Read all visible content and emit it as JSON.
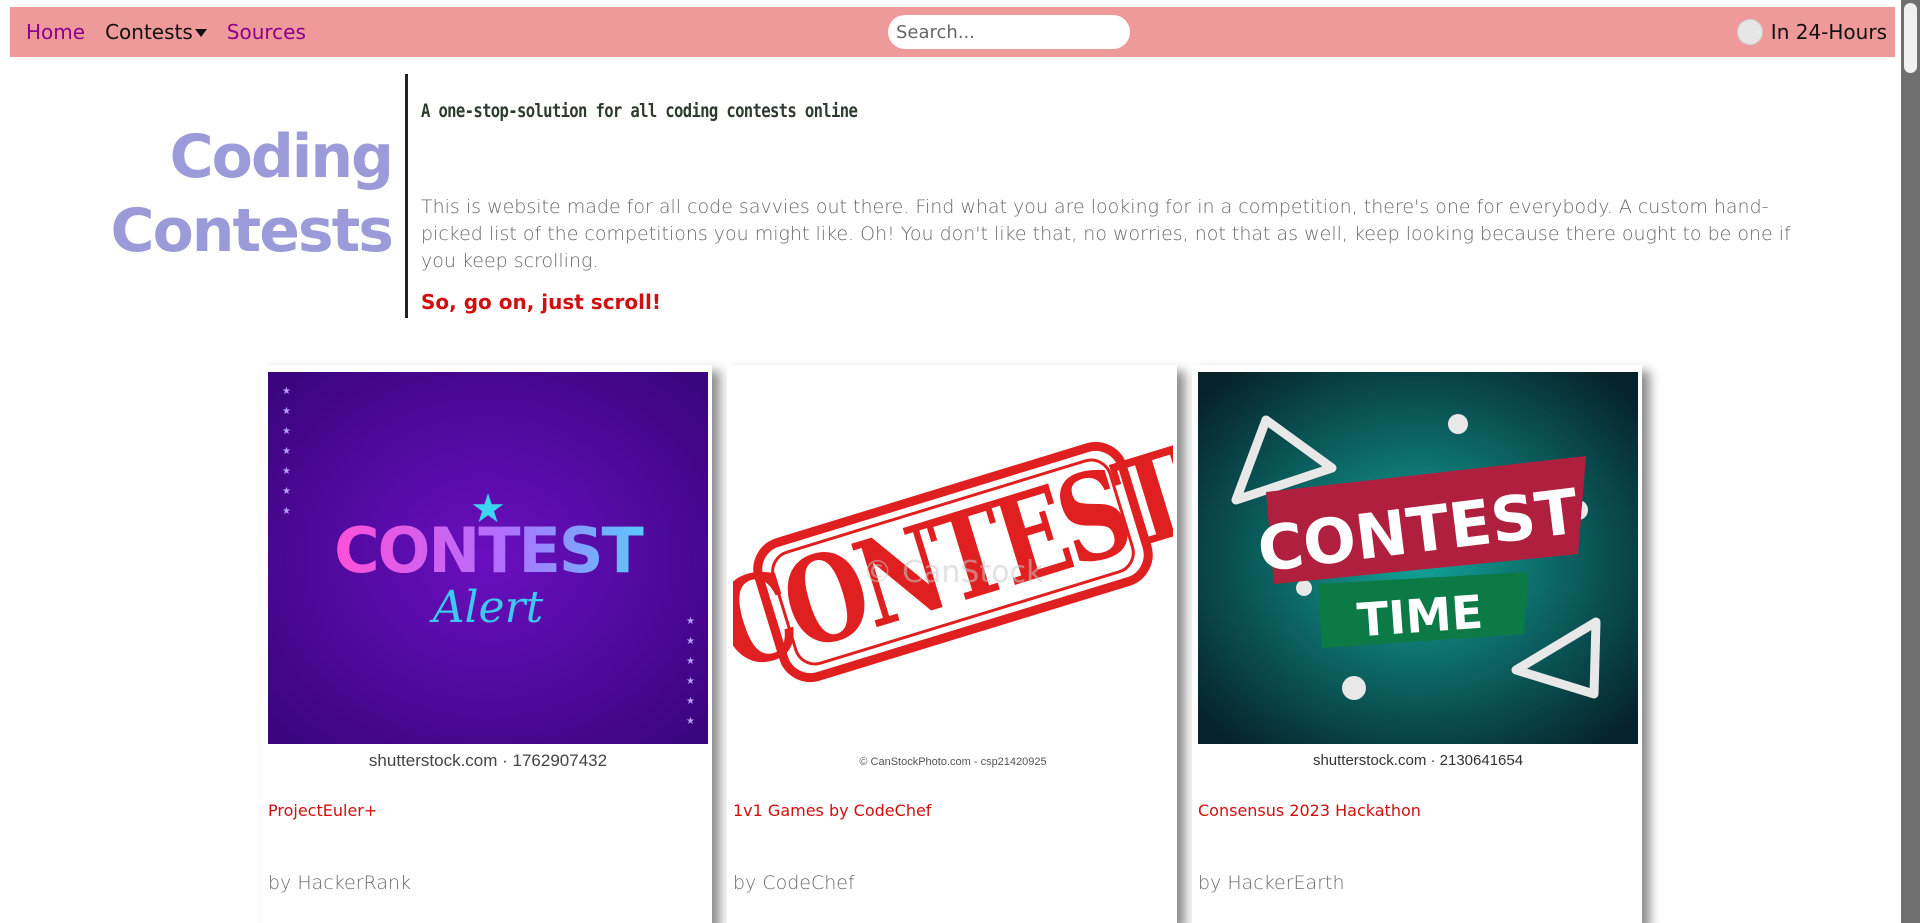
{
  "colors": {
    "nav_bg": "#ef9a9a",
    "link_purple": "#8b008b",
    "title_lavender": "#9b9bd9",
    "accent_red": "#d01010",
    "body_grey": "#6a6a6a"
  },
  "nav": {
    "home": "Home",
    "contests": "Contests",
    "sources": "Sources",
    "search_placeholder": "Search...",
    "toggle_label": "In 24-Hours"
  },
  "hero": {
    "title_line1": "Coding",
    "title_line2": "Contests",
    "tagline": "A one-stop-solution for all coding contests online",
    "description": "This is website made for all code savvies out there. Find what you are looking for in a competition, there's one for everybody. A custom hand-picked list of the competitions you might like. Oh! You don't like that, no worries, not that as well, keep looking because there ought to be one if you keep scrolling.",
    "cta": "So, go on, just scroll!"
  },
  "cards": [
    {
      "title": "ProjectEuler+",
      "org": "by HackerRank",
      "image": {
        "headline": "CONTEST",
        "subline": "Alert",
        "credit": "shutterstock.com · 1762907432"
      }
    },
    {
      "title": "1v1 Games by CodeChef",
      "org": "by CodeChef",
      "image": {
        "headline": "CONTEST",
        "watermark": "© CanStock",
        "credit": "© CanStockPhoto.com - csp21420925"
      }
    },
    {
      "title": "Consensus 2023 Hackathon",
      "org": "by HackerEarth",
      "image": {
        "headline": "CONTEST",
        "subline": "TIME",
        "credit": "shutterstock.com · 2130641654"
      }
    }
  ]
}
